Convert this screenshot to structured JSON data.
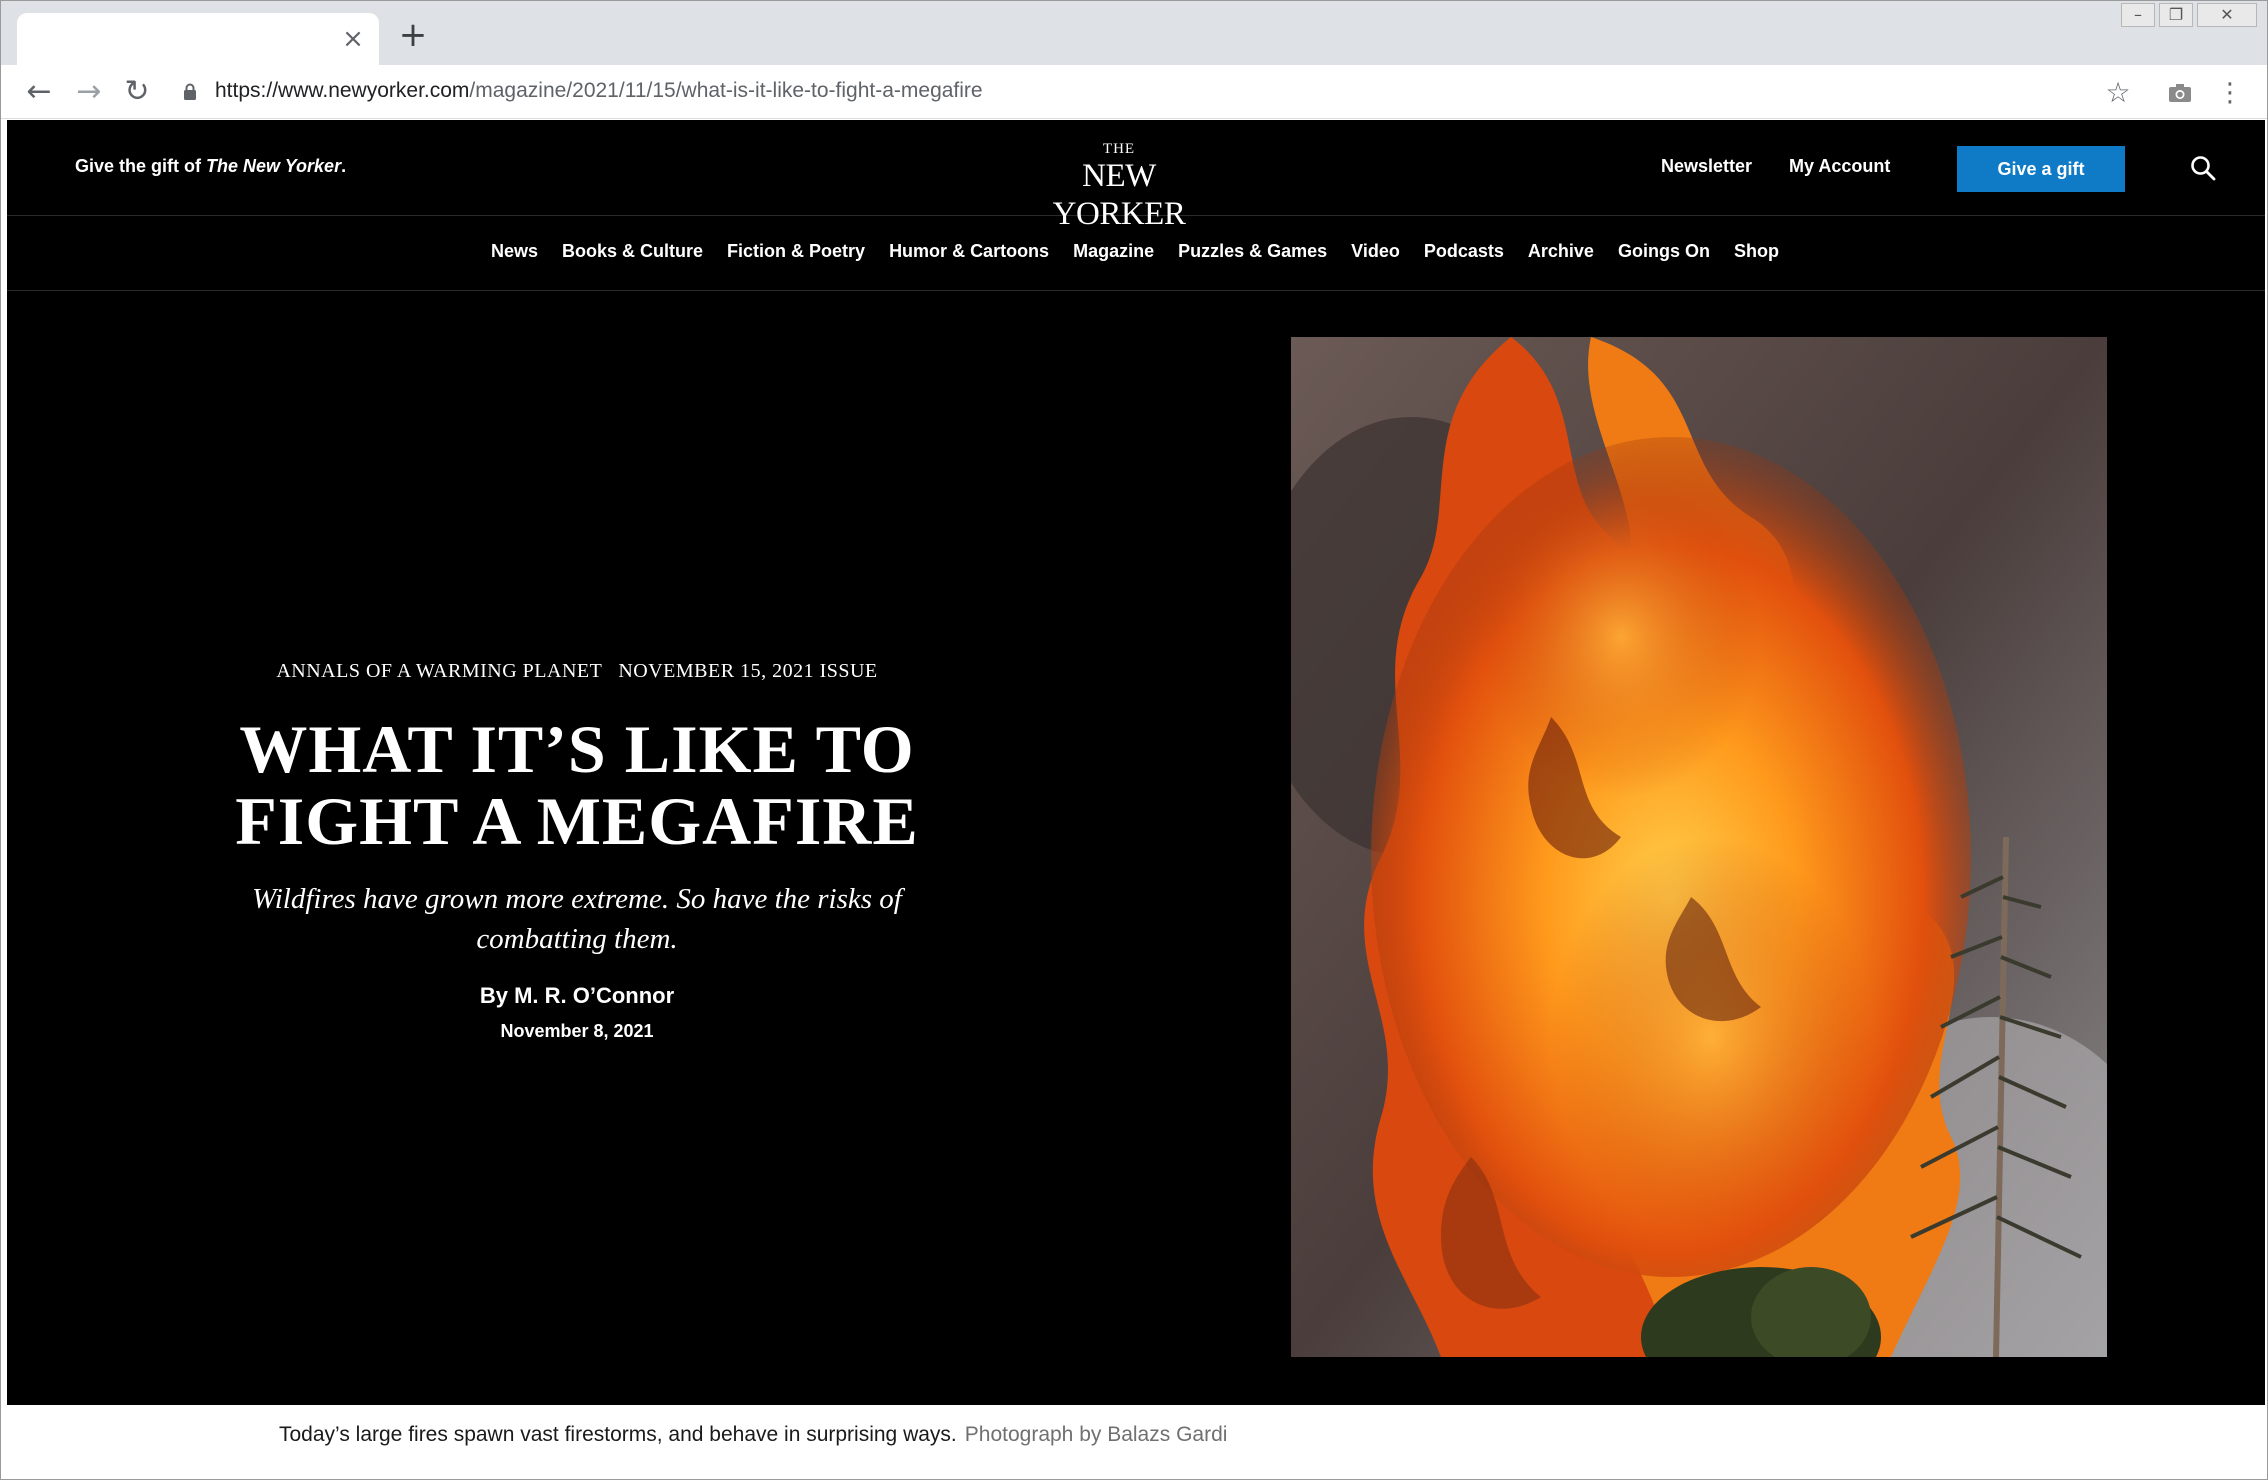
{
  "browser": {
    "tab_close": "×",
    "new_tab": "+",
    "url_host": "https://www.newyorker.com",
    "url_path": "/magazine/2021/11/15/what-is-it-like-to-fight-a-megafire",
    "icons": [
      "back-icon",
      "forward-icon",
      "reload-icon",
      "lock-icon",
      "star-icon",
      "camera-icon",
      "menu-icon",
      "minimize-icon",
      "restore-icon",
      "close-icon"
    ]
  },
  "header": {
    "promo_prefix": "Give the gift of ",
    "promo_italic": "The New Yorker",
    "promo_suffix": ".",
    "logo_the": "THE",
    "logo_main": "NEW YORKER",
    "newsletter": "Newsletter",
    "account": "My Account",
    "gift_button": "Give a gift"
  },
  "nav": {
    "items": [
      "News",
      "Books & Culture",
      "Fiction & Poetry",
      "Humor & Cartoons",
      "Magazine",
      "Puzzles & Games",
      "Video",
      "Podcasts",
      "Archive",
      "Goings On",
      "Shop"
    ]
  },
  "article": {
    "rubric": "ANNALS OF A WARMING PLANET",
    "issue": "NOVEMBER 15, 2021 ISSUE",
    "headline_line1": "WHAT IT’S LIKE TO",
    "headline_line2": "FIGHT A MEGAFIRE",
    "dek": "Wildfires have grown more extreme. So have the risks of combatting them.",
    "byline": "By M. R. O’Connor",
    "date": "November 8, 2021",
    "caption": "Today’s large fires spawn vast firestorms, and behave in surprising ways.",
    "credit": "Photograph by Balazs Gardi"
  },
  "colors": {
    "page_bg": "#000000",
    "gift_button": "#0f7ac6",
    "tabstrip": "#dee1e6"
  }
}
